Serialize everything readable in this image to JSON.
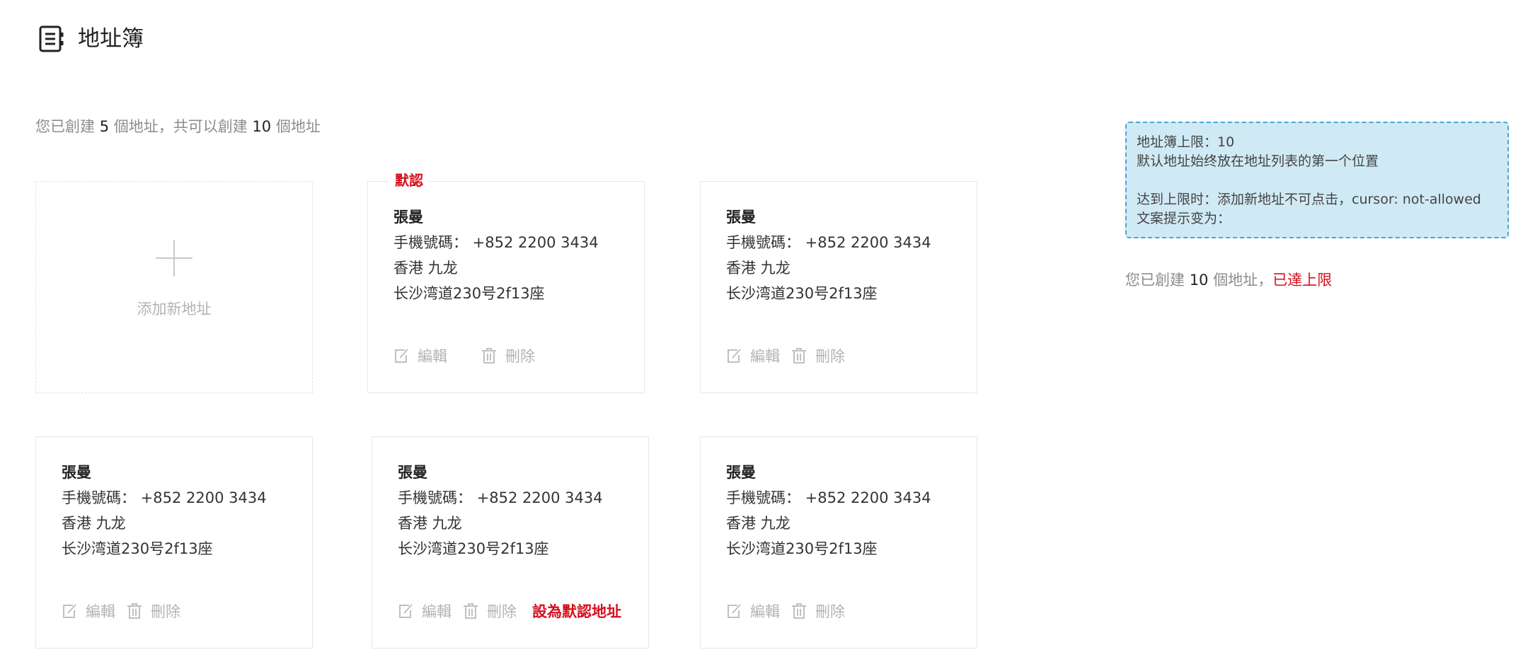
{
  "header": {
    "title": "地址簿",
    "icon": "address-book-icon"
  },
  "summary": {
    "prefix": "您已創建 ",
    "created": "5",
    "middle": " 個地址，共可以創建 ",
    "limit": "10",
    "suffix": " 個地址"
  },
  "add_card": {
    "label": "添加新地址",
    "icon": "plus-icon"
  },
  "labels": {
    "default_tag": "默認",
    "edit": "編輯",
    "delete": "刪除",
    "set_default": "設為默認地址"
  },
  "addresses": [
    {
      "name": "張曼",
      "phone": "手機號碼： +852 2200 3434",
      "region": "香港 九龙",
      "street": "长沙湾道230号2f13座",
      "is_default": true
    },
    {
      "name": "張曼",
      "phone": "手機號碼： +852 2200 3434",
      "region": "香港 九龙",
      "street": "长沙湾道230号2f13座",
      "is_default": false
    },
    {
      "name": "張曼",
      "phone": "手機號碼： +852 2200 3434",
      "region": "香港 九龙",
      "street": "长沙湾道230号2f13座",
      "is_default": false
    },
    {
      "name": "張曼",
      "phone": "手機號碼： +852 2200 3434",
      "region": "香港 九龙",
      "street": "长沙湾道230号2f13座",
      "is_default": false
    },
    {
      "name": "張曼",
      "phone": "手機號碼： +852 2200 3434",
      "region": "香港 九龙",
      "street": "长沙湾道230号2f13座",
      "is_default": false
    }
  ],
  "note": {
    "line1": "地址簿上限：10",
    "line2": "默认地址始终放在地址列表的第一个位置",
    "line3": "达到上限时：添加新地址不可点击，cursor: not-allowed",
    "line4": "文案提示变为："
  },
  "limit_message": {
    "prefix": "您已創建 ",
    "count": "10",
    "middle": " 個地址，",
    "reached": "已達上限"
  },
  "colors": {
    "accent_red": "#d4101c",
    "muted_text": "#8c8c8c",
    "note_background": "#d0eaf5",
    "note_border": "#4aa6d6"
  }
}
